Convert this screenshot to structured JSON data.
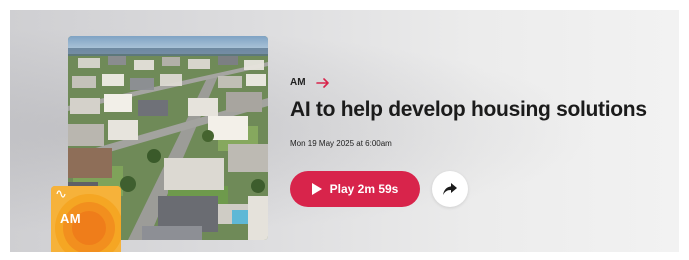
{
  "episode": {
    "program_name": "AM",
    "title": "AI to help develop housing solutions",
    "date": "Mon 19 May 2025 at 6:00am",
    "play_label": "Play 2m 59s"
  },
  "program_tile": {
    "label": "AM"
  },
  "icons": {
    "program_arrow": "arrow-right-icon",
    "play": "play-icon",
    "share": "share-icon",
    "broadcaster": "abc-logo-icon"
  },
  "colors": {
    "accent": "#d8244b",
    "tile": "#f5a623"
  }
}
